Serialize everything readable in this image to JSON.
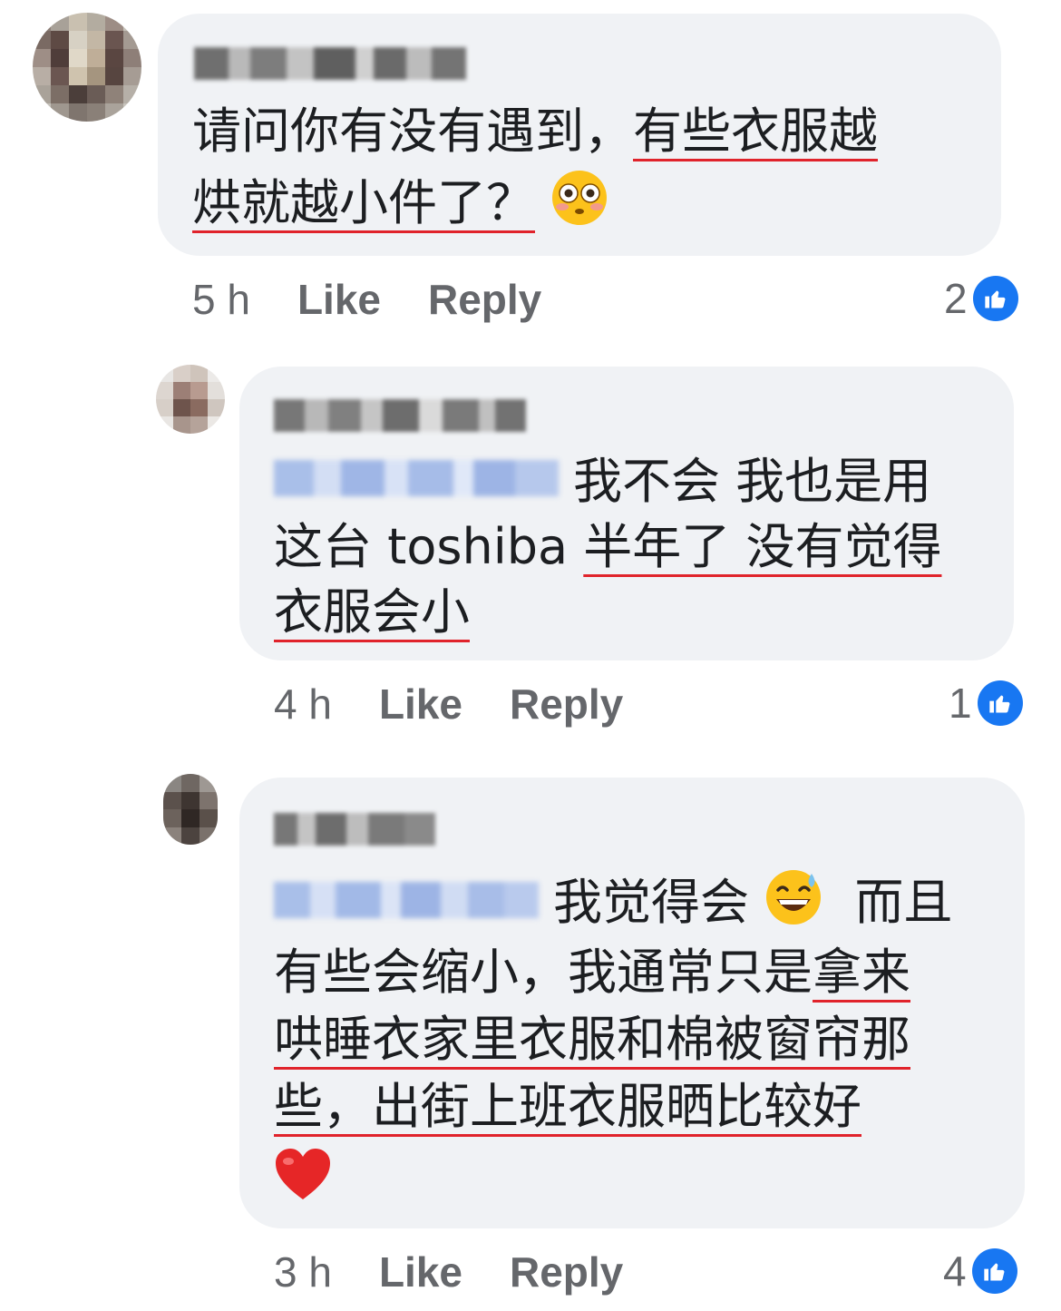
{
  "colors": {
    "bubble": "#f0f2f5",
    "meta_text": "#65676b",
    "underline": "#e0232b",
    "like_blue": "#1877f2",
    "mention_blue": "#a9bfe9"
  },
  "comments": [
    {
      "avatar_icon": "blurred-avatar-icon",
      "author_blurred": true,
      "text_line1_a": "请问你有没有遇到，",
      "text_line1_b": "有些衣服越",
      "text_line2_a": "烘就越小件了？",
      "emoji": "flushed-face-icon",
      "time": "5 h",
      "like_label": "Like",
      "reply_label": "Reply",
      "reactions": "2",
      "reaction_icon": "thumbs-up-icon"
    },
    {
      "avatar_icon": "blurred-avatar-icon",
      "author_blurred": true,
      "mention_blurred": true,
      "text_line1": "我不会 我也是用",
      "text_line2_a": "这台 toshiba ",
      "text_line2_b": "半年了 没有觉得",
      "text_line3": "衣服会小",
      "time": "4 h",
      "like_label": "Like",
      "reply_label": "Reply",
      "reactions": "1",
      "reaction_icon": "thumbs-up-icon"
    },
    {
      "avatar_icon": "blurred-avatar-icon",
      "author_blurred": true,
      "mention_blurred": true,
      "text_line1_a": "我觉得会",
      "emoji": "grinning-sweat-face-icon",
      "text_line1_b": "而且",
      "text_line2_a": "有些会缩小，我通常只是",
      "text_line2_b": "拿来",
      "text_line3": "哄睡衣家里衣服和棉被窗帘那",
      "text_line4": "些，出街上班衣服晒比较好",
      "emoji_end": "red-heart-icon",
      "time": "3 h",
      "like_label": "Like",
      "reply_label": "Reply",
      "reactions": "4",
      "reaction_icon": "thumbs-up-icon"
    }
  ]
}
